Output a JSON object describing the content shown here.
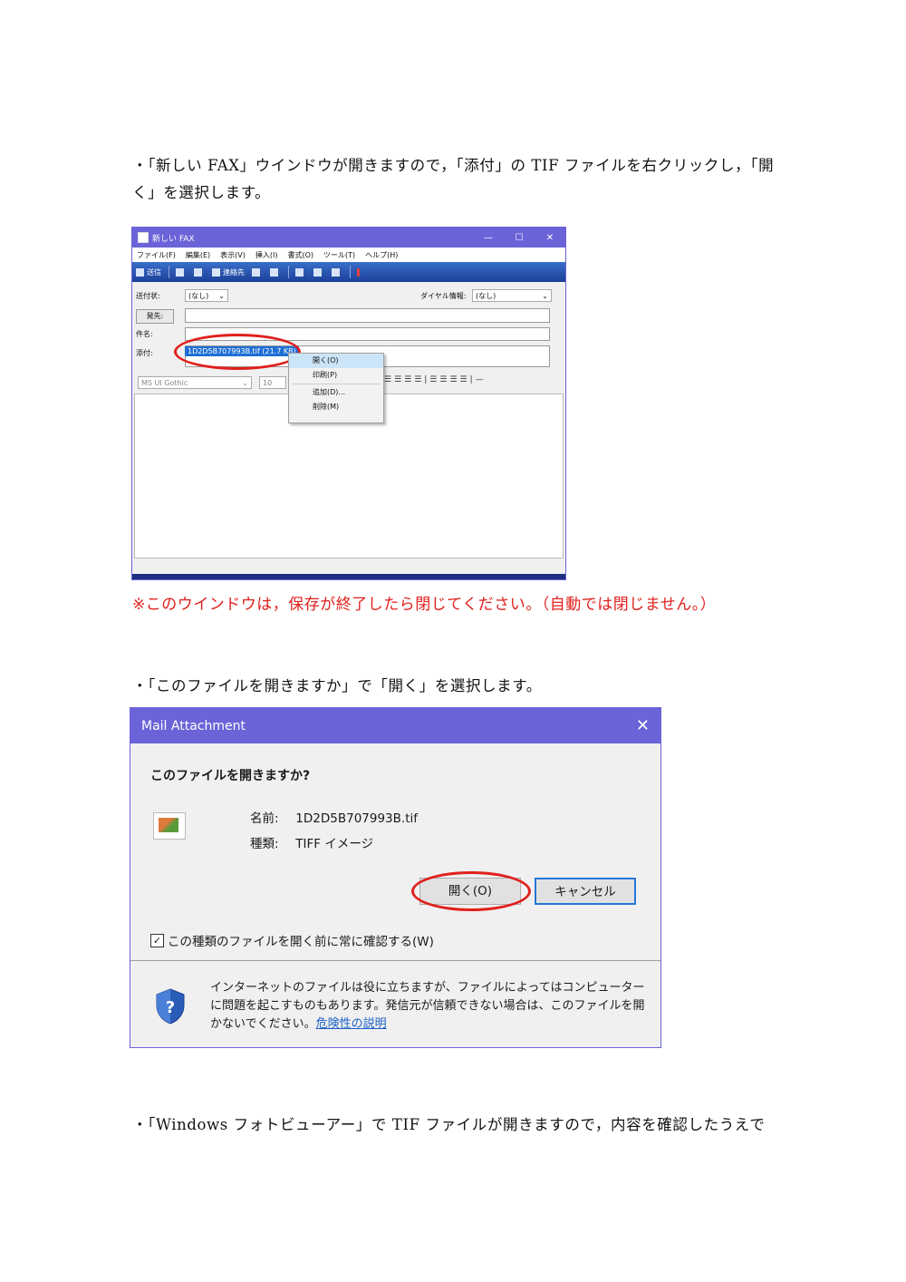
{
  "paragraphs": {
    "p1": "・「新しい FAX」ウインドウが開きますので，「添付」の TIF ファイルを右クリックし，「開く」を選択します。",
    "p2": "・「このファイルを開きますか」で「開く」を選択します。",
    "p3": "・「Windows フォトビューアー」で TIF ファイルが開きますので，内容を確認したうえで"
  },
  "note": "※このウインドウは，保存が終了したら閉じてください。（自動では閉じません。）",
  "fax_window": {
    "title": "新しい FAX",
    "controls": {
      "min": "—",
      "max": "☐",
      "close": "✕"
    },
    "menu": [
      "ファイル(F)",
      "編集(E)",
      "表示(V)",
      "挿入(I)",
      "書式(O)",
      "ツール(T)",
      "ヘルプ(H)"
    ],
    "toolbar": {
      "send": "送信",
      "contacts": "連絡先"
    },
    "labels": {
      "sender": "送付状:",
      "to_button": "発先:",
      "subject": "件名:",
      "attachment": "添付:",
      "dial_info": "ダイヤル情報:"
    },
    "sender_value": "(なし)",
    "dial_value": "(なし)",
    "attachment_file": "1D2D5B707993B.tif (21.7 KB)",
    "font_name": "MS UI Gothic",
    "font_size": "10",
    "context_menu": {
      "open": "開く(O)",
      "print": "印刷(P)",
      "add": "追加(D)...",
      "delete": "削除(M)"
    }
  },
  "mail_dialog": {
    "title": "Mail Attachment",
    "close": "✕",
    "question": "このファイルを開きますか?",
    "name_label": "名前:",
    "name_value": "1D2D5B707993B.tif",
    "type_label": "種類:",
    "type_value": "TIFF イメージ",
    "open_button": "開く(O)",
    "cancel_button": "キャンセル",
    "checkbox_label": "この種類のファイルを開く前に常に確認する(W)",
    "checkbox_mark": "✓",
    "warning_text": "インターネットのファイルは役に立ちますが、ファイルによってはコンピューターに問題を起こすものもあります。発信元が信頼できない場合は、このファイルを開かないでください。",
    "warning_link": "危険性の説明",
    "colors": {
      "titlebar": "#6b63d8",
      "highlight": "#e0201c"
    }
  }
}
